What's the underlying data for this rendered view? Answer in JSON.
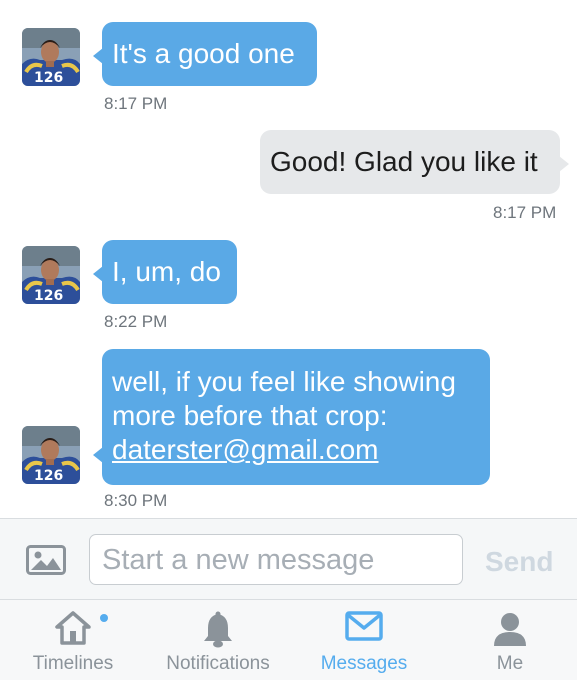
{
  "messages": [
    {
      "direction": "in",
      "lines": [
        "It's a good one"
      ],
      "time": "8:17 PM"
    },
    {
      "direction": "out",
      "lines": [
        "Good! Glad you like it"
      ],
      "time": "8:17 PM"
    },
    {
      "direction": "in",
      "lines": [
        "I, um, do"
      ],
      "time": "8:22 PM"
    },
    {
      "direction": "in",
      "lines": [
        "well, if you feel like showing",
        "more before that crop:"
      ],
      "link": "daterster@gmail.com",
      "time": "8:30 PM"
    }
  ],
  "composer": {
    "placeholder": "Start a new message",
    "send_label": "Send",
    "image_icon": "image-icon"
  },
  "tabs": [
    {
      "label": "Timelines",
      "icon": "home-icon",
      "active": false,
      "has_dot": true
    },
    {
      "label": "Notifications",
      "icon": "bell-icon",
      "active": false
    },
    {
      "label": "Messages",
      "icon": "envelope-icon",
      "active": true
    },
    {
      "label": "Me",
      "icon": "person-icon",
      "active": false
    }
  ],
  "colors": {
    "incoming_bubble": "#5aa9e6",
    "outgoing_bubble": "#e6e8ea",
    "accent": "#55acee",
    "muted": "#8b939a"
  }
}
